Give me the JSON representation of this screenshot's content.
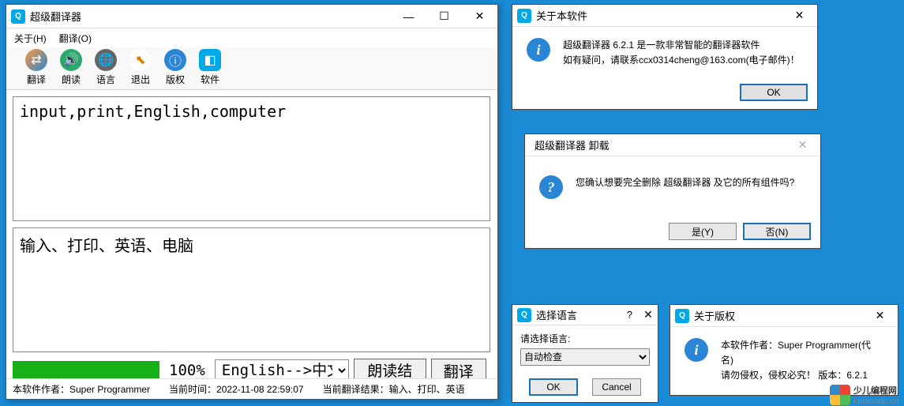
{
  "main": {
    "title": "超级翻译器",
    "menu": {
      "help": "关于(H)",
      "translate": "翻译(O)"
    },
    "toolbar": [
      {
        "name": "translate-btn",
        "label": "翻译",
        "icon": "translate"
      },
      {
        "name": "read-btn",
        "label": "朗读",
        "icon": "sound"
      },
      {
        "name": "language-btn",
        "label": "语言",
        "icon": "globe"
      },
      {
        "name": "exit-btn",
        "label": "退出",
        "icon": "exit"
      },
      {
        "name": "copyright-btn",
        "label": "版权",
        "icon": "copyright"
      },
      {
        "name": "software-btn",
        "label": "软件",
        "icon": "software"
      }
    ],
    "input_text": "input,print,English,computer",
    "output_text": "输入、打印、英语、电脑",
    "progress_pct": "100%",
    "lang_pair": "English-->中文",
    "read_result_btn": "朗读结果",
    "translate_btn": "翻译",
    "status": {
      "author": "本软件作者：Super Programmer",
      "time": "当前时间：2022-11-08 22:59:07",
      "result": "当前翻译结果：输入、打印、英语"
    }
  },
  "about": {
    "title": "关于本软件",
    "line1": "超级翻译器  6.2.1   是一款非常智能的翻译器软件",
    "line2": "如有疑问，请联系ccx0314cheng@163.com(电子邮件)！",
    "ok": "OK"
  },
  "uninstall": {
    "title": "超级翻译器 卸载",
    "msg": "您确认想要完全删除 超级翻译器 及它的所有组件吗?",
    "yes": "是(Y)",
    "no": "否(N)"
  },
  "lang_dlg": {
    "title": "选择语言",
    "label": "请选择语言:",
    "value": "自动检查",
    "ok": "OK",
    "cancel": "Cancel"
  },
  "copyright_dlg": {
    "title": "关于版权",
    "line1": "本软件作者：Super Programmer(代名)",
    "line2": "请勿侵权，侵权必究！  版本：6.2.1"
  },
  "watermark": {
    "brand": "少儿编程网",
    "domain": "kidscode.cn"
  },
  "glyphs": {
    "min": "—",
    "max": "☐",
    "close": "✕",
    "help": "?",
    "info": "i",
    "question": "?",
    "sound": "🔊",
    "globe": "🌐",
    "exit": "↗",
    "cr": "ⓘ",
    "sw": "◧"
  }
}
